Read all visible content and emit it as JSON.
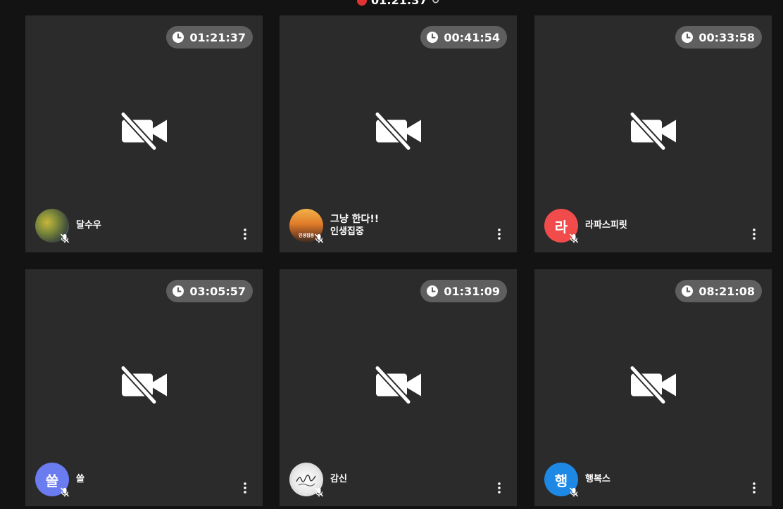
{
  "session": {
    "elapsed": "01:21:37"
  },
  "participants": [
    {
      "time": "01:21:37",
      "status": "",
      "name": "달수우",
      "avatar_text": "",
      "avatar_type": "photo-tree"
    },
    {
      "time": "00:41:54",
      "status": "그냥 한다!!",
      "name": "인생집중",
      "avatar_text": "인생집중",
      "avatar_type": "photo-sunset"
    },
    {
      "time": "00:33:58",
      "status": "",
      "name": "라파스피릿",
      "avatar_text": "라",
      "avatar_type": "letter",
      "avatar_color": "#f24b4b"
    },
    {
      "time": "03:05:57",
      "status": "",
      "name": "쓸",
      "avatar_text": "쓸",
      "avatar_type": "letter",
      "avatar_color": "#6b7cf0"
    },
    {
      "time": "01:31:09",
      "status": "",
      "name": "감신",
      "avatar_text": "",
      "avatar_type": "photo-calligraphy"
    },
    {
      "time": "08:21:08",
      "status": "",
      "name": "행복스",
      "avatar_text": "행",
      "avatar_type": "letter",
      "avatar_color": "#1e88e5"
    }
  ],
  "icons": {
    "recording": "red-dot-icon",
    "clock": "clock-icon",
    "camera": "video-off-icon",
    "mic": "mic-off-icon",
    "menu": "more-vertical-icon"
  }
}
